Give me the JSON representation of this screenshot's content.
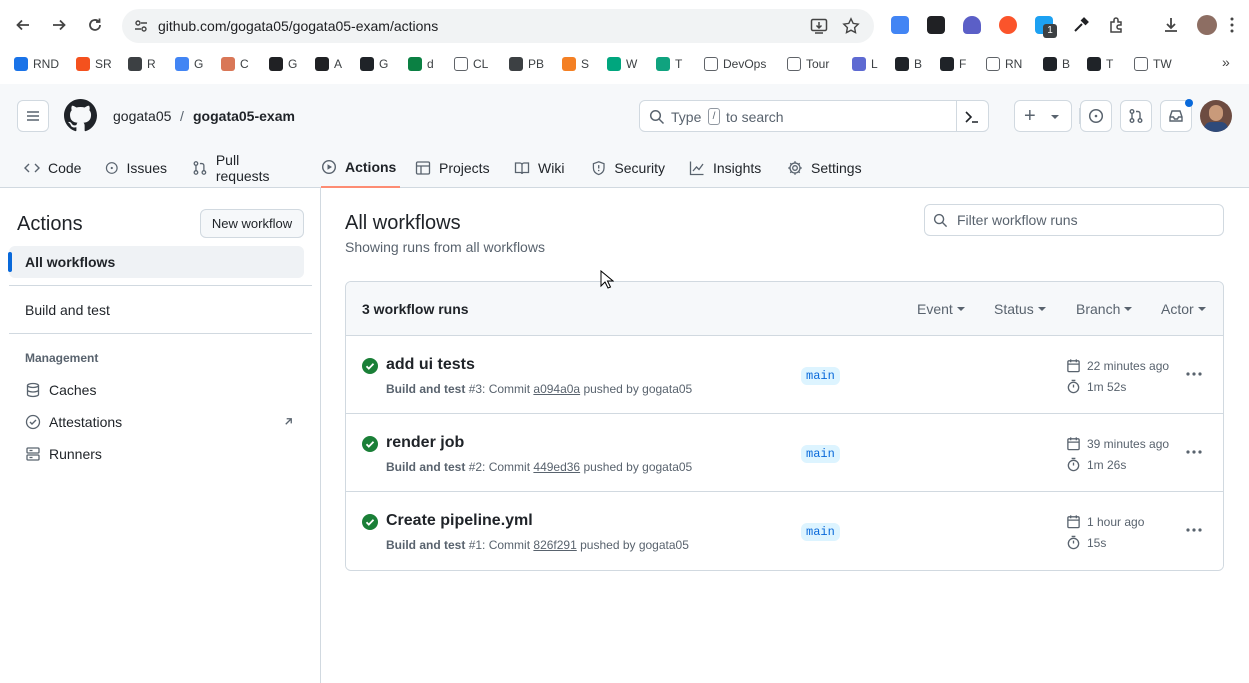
{
  "browser": {
    "url": "github.com/gogata05/gogata05-exam/actions",
    "bookmarks": [
      {
        "label": "RND",
        "color": "#1a73e8"
      },
      {
        "label": "SR",
        "color": "#f4511e"
      },
      {
        "label": "R",
        "color": "#3c4043"
      },
      {
        "label": "G",
        "color": "#4285f4"
      },
      {
        "label": "C",
        "color": "#d97757"
      },
      {
        "label": "G",
        "color": "#202124"
      },
      {
        "label": "A",
        "color": "#202124"
      },
      {
        "label": "G",
        "color": "#1f2328"
      },
      {
        "label": "d",
        "color": "#0b8043"
      },
      {
        "label": "CL",
        "color": "#3c4043"
      },
      {
        "label": "PB",
        "color": "#3c4043"
      },
      {
        "label": "S",
        "color": "#f48024"
      },
      {
        "label": "W",
        "color": "#00a67e"
      },
      {
        "label": "T",
        "color": "#10a37f"
      },
      {
        "label": "DevOps",
        "color": "#3c4043"
      },
      {
        "label": "Tour",
        "color": "#3c4043"
      },
      {
        "label": "L",
        "color": "#5e6ad2"
      },
      {
        "label": "B",
        "color": "#1f2328"
      },
      {
        "label": "F",
        "color": "#1f2328"
      },
      {
        "label": "RN",
        "color": "#3c4043"
      },
      {
        "label": "B",
        "color": "#1f2328"
      },
      {
        "label": "T",
        "color": "#1f2328"
      },
      {
        "label": "TW",
        "color": "#3c4043"
      }
    ],
    "ext_badge": "1"
  },
  "header": {
    "owner": "gogata05",
    "separator": "/",
    "repo": "gogata05-exam",
    "search_placeholder_pre": "Type",
    "search_key": "/",
    "search_placeholder_post": "to search",
    "plus": "+"
  },
  "tabs": [
    {
      "label": "Code",
      "icon": "code-icon"
    },
    {
      "label": "Issues",
      "icon": "issue-icon"
    },
    {
      "label": "Pull requests",
      "icon": "pull-request-icon"
    },
    {
      "label": "Actions",
      "icon": "play-icon"
    },
    {
      "label": "Projects",
      "icon": "table-icon"
    },
    {
      "label": "Wiki",
      "icon": "book-icon"
    },
    {
      "label": "Security",
      "icon": "shield-icon"
    },
    {
      "label": "Insights",
      "icon": "graph-icon"
    },
    {
      "label": "Settings",
      "icon": "gear-icon"
    }
  ],
  "sidebar": {
    "title": "Actions",
    "new_workflow": "New workflow",
    "all_workflows": "All workflows",
    "build_and_test": "Build and test",
    "management_heading": "Management",
    "management": [
      {
        "label": "Caches",
        "icon": "database-icon"
      },
      {
        "label": "Attestations",
        "icon": "verified-icon"
      },
      {
        "label": "Runners",
        "icon": "server-icon"
      }
    ]
  },
  "main": {
    "title": "All workflows",
    "subtitle": "Showing runs from all workflows",
    "filter_placeholder": "Filter workflow runs",
    "runs_count": "3 workflow runs",
    "filters": [
      "Event",
      "Status",
      "Branch",
      "Actor"
    ],
    "runs": [
      {
        "title": "add ui tests",
        "workflow": "Build and test",
        "number": "#3",
        "commit_label": ": Commit",
        "sha": "a094a0a",
        "pushed_by": "pushed by gogata05",
        "branch": "main",
        "time": "22 minutes ago",
        "duration": "1m 52s"
      },
      {
        "title": "render job",
        "workflow": "Build and test",
        "number": "#2",
        "commit_label": ": Commit",
        "sha": "449ed36",
        "pushed_by": "pushed by gogata05",
        "branch": "main",
        "time": "39 minutes ago",
        "duration": "1m 26s"
      },
      {
        "title": "Create pipeline.yml",
        "workflow": "Build and test",
        "number": "#1",
        "commit_label": ": Commit",
        "sha": "826f291",
        "pushed_by": "pushed by gogata05",
        "branch": "main",
        "time": "1 hour ago",
        "duration": "15s"
      }
    ]
  },
  "colors": {
    "success": "#1a7f37",
    "accent_tab": "#fd8c73",
    "link": "#0969da",
    "active_indicator": "#0969da"
  }
}
